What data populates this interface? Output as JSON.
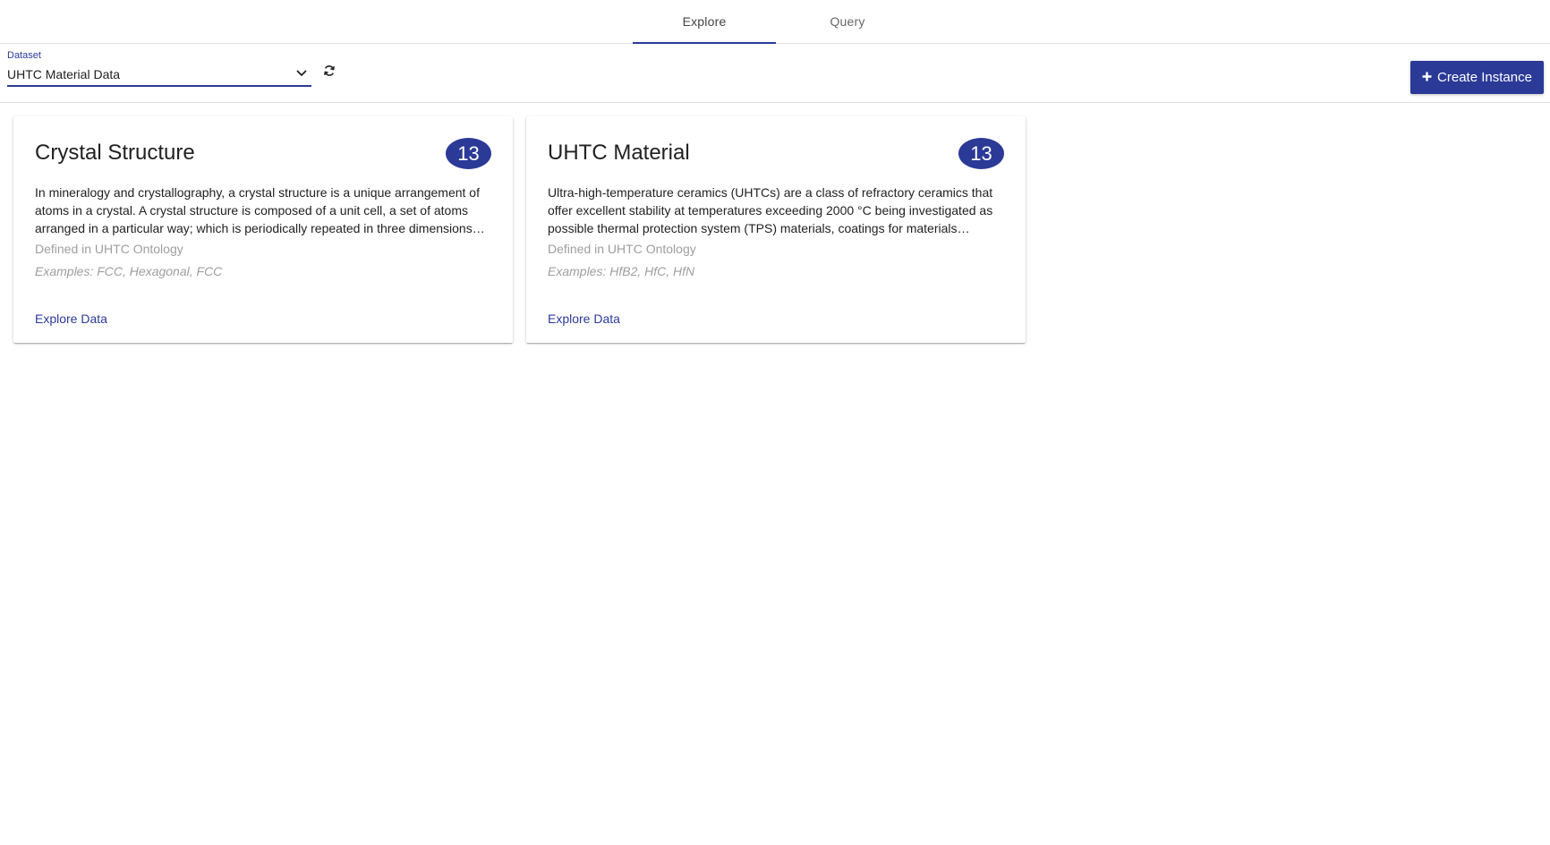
{
  "tabs": [
    {
      "label": "Explore",
      "active": true
    },
    {
      "label": "Query",
      "active": false
    }
  ],
  "toolbar": {
    "dataset_label": "Dataset",
    "dataset_value": "UHTC Material Data",
    "create_label": "Create Instance"
  },
  "cards": [
    {
      "title": "Crystal Structure",
      "count": "13",
      "description": "In mineralogy and crystallography, a crystal structure is a unique arrangement of atoms in a crystal. A crystal structure is composed of a unit cell, a set of atoms arranged in a particular way; which is periodically repeated in three dimensions…",
      "defined_in": "Defined in UHTC Ontology",
      "examples": "Examples: FCC, Hexagonal, FCC",
      "link": "Explore Data"
    },
    {
      "title": "UHTC Material",
      "count": "13",
      "description": "Ultra-high-temperature ceramics (UHTCs) are a class of refractory ceramics that offer excellent stability at temperatures exceeding 2000 °C being investigated as possible thermal protection system (TPS) materials, coatings for materials…",
      "defined_in": "Defined in UHTC Ontology",
      "examples": "Examples: HfB2, HfC, HfN",
      "link": "Explore Data"
    }
  ],
  "colors": {
    "accent": "#2b3a97",
    "muted": "#9e9e9e",
    "text": "#212121"
  },
  "icons": {
    "dropdown": "chevron-down-icon",
    "refresh": "refresh-icon",
    "create": "plus-icon"
  }
}
